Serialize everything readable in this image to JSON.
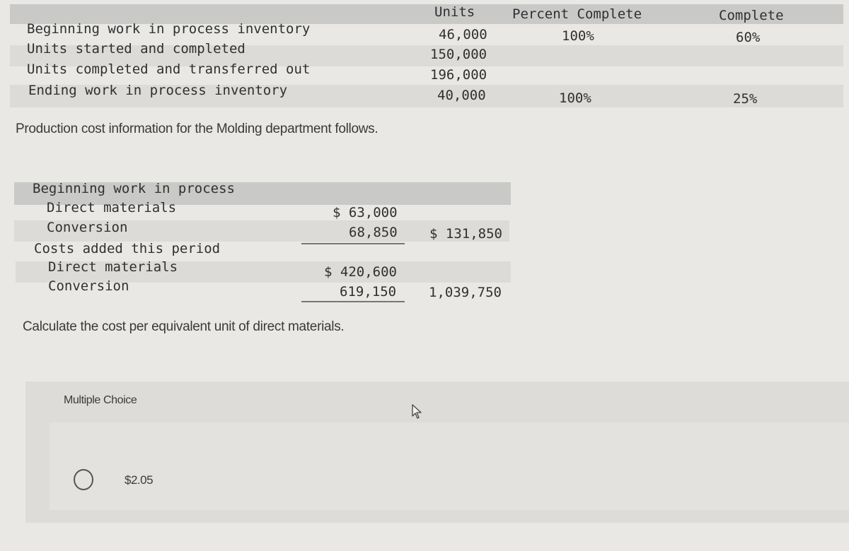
{
  "units_table": {
    "headers": {
      "units": "Units",
      "percent_complete_materials": "Percent Complete",
      "percent_complete_conversion": "Complete"
    },
    "rows": [
      {
        "label": "Beginning work in process inventory",
        "units": "46,000",
        "materials_pct": "100%",
        "conversion_pct": "60%"
      },
      {
        "label": "Units started and completed",
        "units": "150,000",
        "materials_pct": "",
        "conversion_pct": ""
      },
      {
        "label": "Units completed and transferred out",
        "units": "196,000",
        "materials_pct": "",
        "conversion_pct": ""
      },
      {
        "label": "Ending work in process inventory",
        "units": "40,000",
        "materials_pct": "100%",
        "conversion_pct": "25%"
      }
    ]
  },
  "intro_text": "Production cost information for the Molding department follows.",
  "cost_table": {
    "beginning_wip": {
      "label": "Beginning work in process",
      "direct_materials_label": "Direct materials",
      "direct_materials_value": "$ 63,000",
      "conversion_label": "Conversion",
      "conversion_value": "68,850",
      "total": "$ 131,850"
    },
    "costs_added": {
      "label": "Costs added this period",
      "direct_materials_label": "Direct materials",
      "direct_materials_value": "$ 420,600",
      "conversion_label": "Conversion",
      "conversion_value": "619,150",
      "total": "1,039,750"
    }
  },
  "question": "Calculate the cost per equivalent unit of direct materials.",
  "multiple_choice": {
    "label": "Multiple Choice",
    "options": [
      {
        "text": "$2.05",
        "selected": false
      }
    ]
  }
}
